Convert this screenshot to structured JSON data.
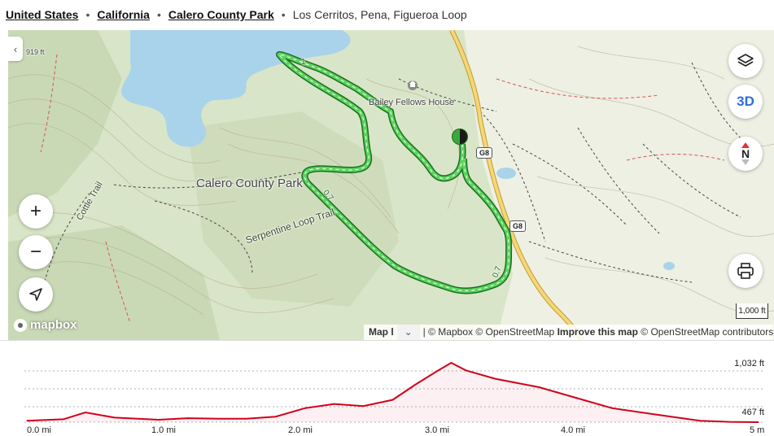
{
  "breadcrumb": {
    "items": [
      "United States",
      "California",
      "Calero County Park"
    ],
    "current": "Los Cerritos, Pena, Figueroa Loop"
  },
  "map": {
    "labels": {
      "park": "Calero County Park",
      "house": "Bailey Fellows House",
      "serpentine": "Serpentine Loop Trail",
      "cottle": "Cottle Trail",
      "elevation_marker": "919 ft"
    },
    "road_shield": "G8",
    "trail_distances": [
      "1",
      "0.7",
      "0.7"
    ],
    "controls": {
      "layers": "layers-icon",
      "three_d": "3D",
      "north": "N",
      "zoom_in": "+",
      "zoom_out": "−"
    },
    "scale_label": "1,000 ft",
    "attribution": {
      "map_legend": "Map l",
      "mapbox": "© Mapbox",
      "osm": "© OpenStreetMap",
      "improve": "Improve this map",
      "osm_contrib": "© OpenStreetMap contributors"
    },
    "logo_text": "mapbox",
    "colors": {
      "water": "#a9d3ea",
      "trail": "#33b044",
      "trail_border": "#1a6e1f",
      "road": "#f4d77a",
      "land": "#d9e5c8"
    }
  },
  "profile": {
    "max_label": "1,032 ft",
    "min_label": "467 ft",
    "x_labels": [
      "0.0 mi",
      "1.0 mi",
      "2.0 mi",
      "3.0 mi",
      "4.0 mi",
      "5 m"
    ],
    "line_color": "#d0021b"
  },
  "chart_data": {
    "type": "area",
    "ylabel": "",
    "xlabel": "",
    "ylim": [
      467,
      1032
    ],
    "x": [
      0,
      0.25,
      0.4,
      0.6,
      0.9,
      1.1,
      1.3,
      1.5,
      1.7,
      1.9,
      2.1,
      2.3,
      2.5,
      2.65,
      2.8,
      2.9,
      3.0,
      3.2,
      3.5,
      3.8,
      4.0,
      4.3,
      4.6,
      4.8,
      5.0
    ],
    "series": [
      {
        "name": "",
        "values": [
          480,
          495,
          560,
          510,
          490,
          505,
          500,
          500,
          520,
          600,
          640,
          620,
          680,
          820,
          950,
          1032,
          960,
          880,
          800,
          680,
          600,
          540,
          480,
          470,
          467
        ]
      }
    ]
  }
}
